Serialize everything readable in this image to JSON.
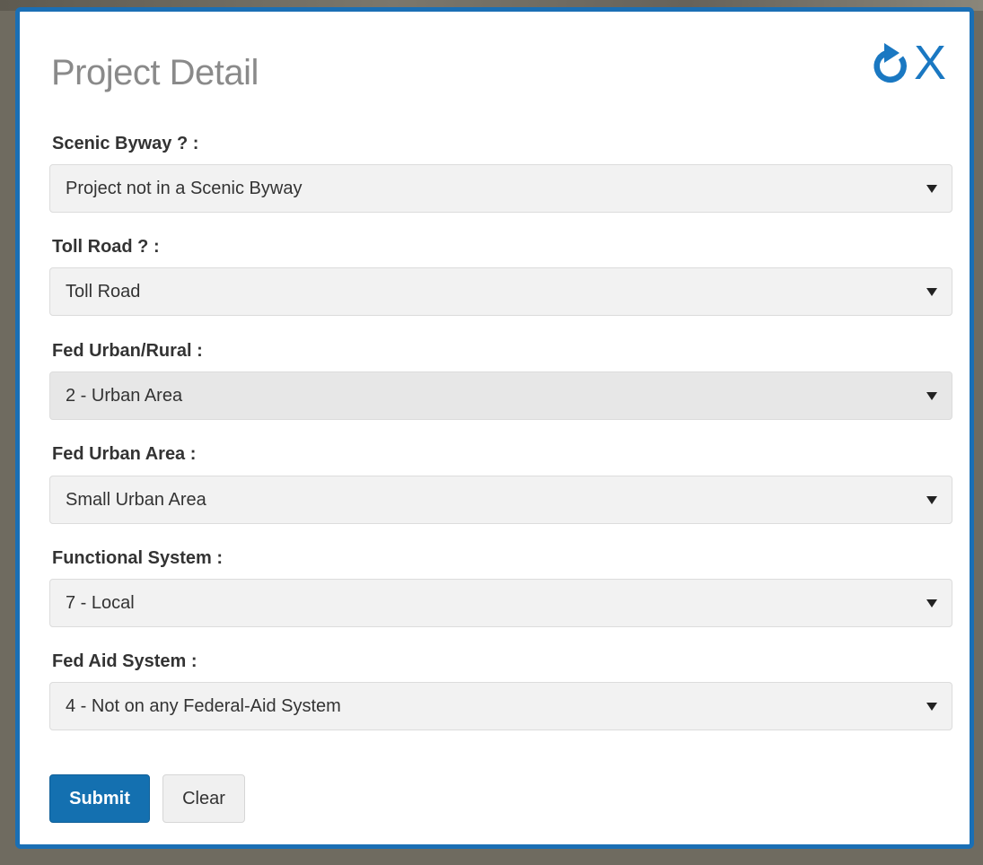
{
  "dialog": {
    "title": "Project Detail",
    "close_label": "X"
  },
  "fields": [
    {
      "label": "Scenic Byway ? :",
      "value": "Project not in a Scenic Byway"
    },
    {
      "label": "Toll Road ? :",
      "value": "Toll Road"
    },
    {
      "label": "Fed Urban/Rural :",
      "value": "2 - Urban Area"
    },
    {
      "label": "Fed Urban Area :",
      "value": "Small Urban Area"
    },
    {
      "label": "Functional System :",
      "value": "7 - Local"
    },
    {
      "label": "Fed Aid System :",
      "value": "4 - Not on any Federal-Aid System"
    }
  ],
  "buttons": {
    "submit_label": "Submit",
    "clear_label": "Clear"
  },
  "colors": {
    "accent": "#1a6fb5",
    "submit_bg": "#1470b0",
    "title_gray": "#8a8a8a"
  },
  "icons": {
    "refresh": "refresh-icon",
    "close": "close-icon",
    "dropdown": "caret-down-icon"
  }
}
